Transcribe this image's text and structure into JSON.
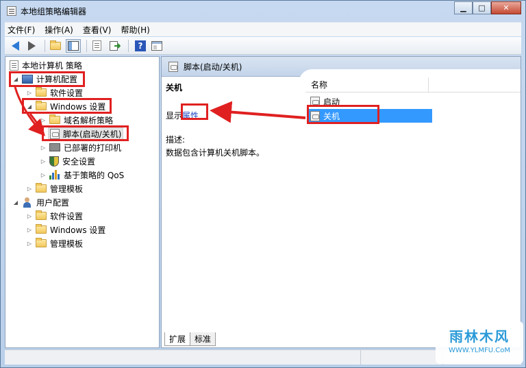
{
  "window": {
    "title": "本地组策略编辑器",
    "minimize": "▁",
    "maximize": "□",
    "close": "✕"
  },
  "menu": [
    "文件(F)",
    "操作(A)",
    "查看(V)",
    "帮助(H)"
  ],
  "toolbar": {
    "icons": [
      "back-arrow-icon",
      "forward-arrow-icon",
      "up-folder-icon",
      "show-hide-tree-icon",
      "properties-icon",
      "export-list-icon",
      "help-icon",
      "extended-view-icon"
    ],
    "help_label": "?"
  },
  "tree": {
    "root": "本地计算机 策略",
    "computer_config": "计算机配置",
    "software_settings_1": "软件设置",
    "windows_settings_1": "Windows 设置",
    "dns_policy": "域名解析策略",
    "scripts": "脚本(启动/关机)",
    "printers": "已部署的打印机",
    "security": "安全设置",
    "qos": "基于策略的 QoS",
    "admin_templates_1": "管理模板",
    "user_config": "用户配置",
    "software_settings_2": "软件设置",
    "windows_settings_2": "Windows 设置",
    "admin_templates_2": "管理模板",
    "expanded_glyph": "◢",
    "collapsed_glyph": "▷"
  },
  "right_pane": {
    "header": "脚本(启动/关机)",
    "section_title": "关机",
    "show_label": "显示",
    "properties_link": "属性",
    "desc_label": "描述:",
    "description": "数据包含计算机关机脚本。",
    "column_name": "名称",
    "items": [
      "启动",
      "关机"
    ],
    "selected_item": "关机"
  },
  "tabs": [
    "扩展",
    "标准"
  ],
  "watermark": {
    "title": "雨林木风",
    "url": "WWW.YLMFU.CoM"
  },
  "colors": {
    "annotation": "#e02020",
    "selection": "#3399ff",
    "link": "#1a44c2"
  }
}
